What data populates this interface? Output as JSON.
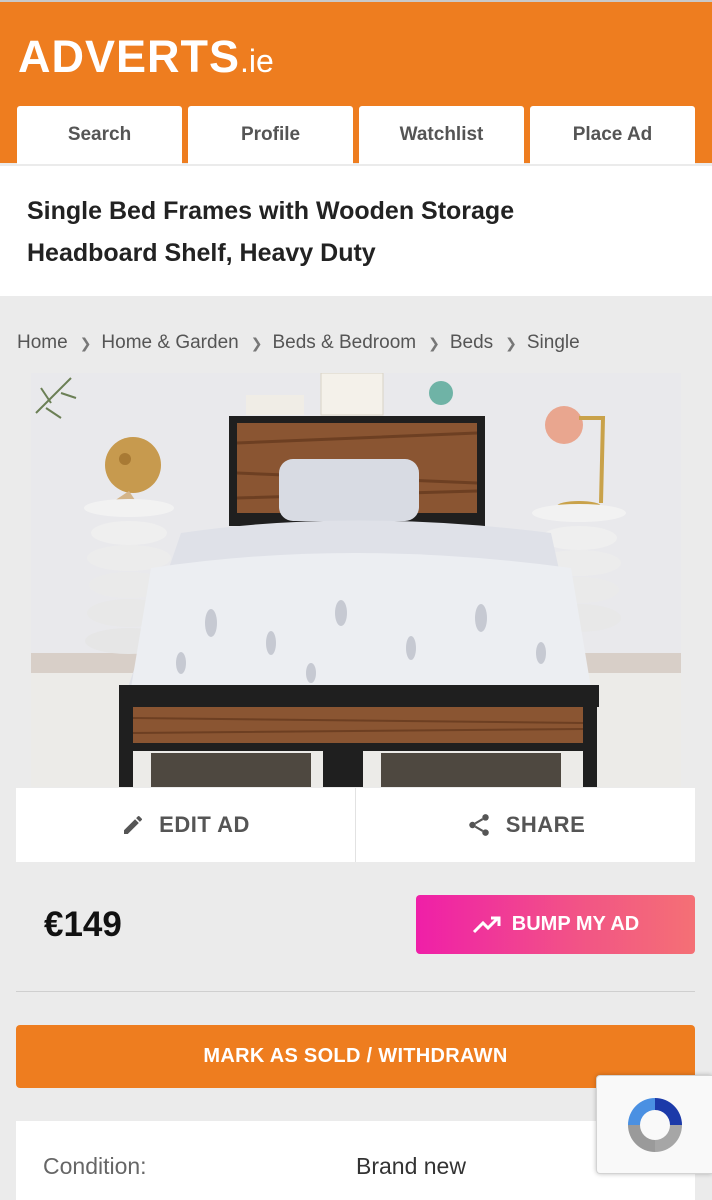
{
  "header": {
    "logo": "ADVERTS",
    "logo_tld": ".ie",
    "brand_color": "#ee7d1f",
    "nav": [
      {
        "label": "Search"
      },
      {
        "label": "Profile"
      },
      {
        "label": "Watchlist"
      },
      {
        "label": "Place Ad"
      }
    ]
  },
  "ad": {
    "title": "Single Bed Frames with Wooden Storage Headboard Shelf, Heavy Duty",
    "price": "€149"
  },
  "breadcrumb": [
    "Home",
    "Home & Garden",
    "Beds & Bedroom",
    "Beds",
    "Single"
  ],
  "actions": {
    "edit_label": "EDIT AD",
    "share_label": "SHARE",
    "bump_label": "BUMP MY AD",
    "sold_label": "MARK AS SOLD / WITHDRAWN"
  },
  "details": {
    "condition_label": "Condition:",
    "condition_value": "Brand new"
  },
  "icons": {
    "edit": "pencil-icon",
    "share": "share-icon",
    "bump": "trending-up-icon",
    "recaptcha": "recaptcha-icon"
  },
  "colors": {
    "accent": "#ee7d1f",
    "bump_gradient_start": "#ef1fa8",
    "bump_gradient_end": "#f47075"
  }
}
